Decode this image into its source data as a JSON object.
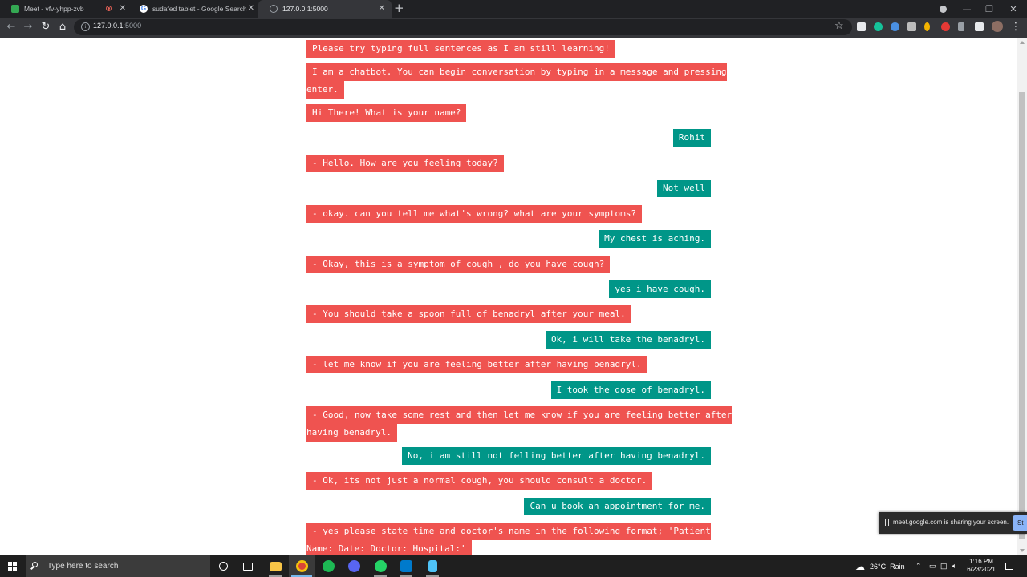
{
  "browser": {
    "tabs": [
      {
        "title": "Meet - vfv-yhpp-zvb",
        "favicon_color": "#34a853",
        "recording": true,
        "active": false
      },
      {
        "title": "sudafed tablet - Google Search",
        "favicon_color": "#ffffff",
        "recording": false,
        "active": false
      },
      {
        "title": "127.0.0.1:5000",
        "favicon_color": "#9aa0a6",
        "recording": false,
        "active": true
      }
    ],
    "new_tab_icon": "plus-icon",
    "address": {
      "host": "127.0.0.1",
      "port": ":5000"
    }
  },
  "chat": {
    "bot_color": "#ef5350",
    "user_color": "#009688",
    "messages": [
      {
        "sender": "bot",
        "lines": [
          "Please try typing full sentences as I am still learning!"
        ]
      },
      {
        "sender": "bot",
        "lines": [
          "I am a chatbot. You can begin conversation by typing in a message and pressing",
          "enter."
        ]
      },
      {
        "sender": "bot",
        "lines": [
          "Hi There! What is your name?"
        ]
      },
      {
        "sender": "user",
        "lines": [
          "Rohit"
        ]
      },
      {
        "sender": "bot",
        "lines": [
          "- Hello. How are you feeling today?"
        ]
      },
      {
        "sender": "user",
        "lines": [
          "Not well"
        ]
      },
      {
        "sender": "bot",
        "lines": [
          "- okay. can you tell me what's wrong? what are your symptoms?"
        ]
      },
      {
        "sender": "user",
        "lines": [
          "My chest is aching."
        ]
      },
      {
        "sender": "bot",
        "lines": [
          "- Okay, this is a symptom of cough , do you have cough?"
        ]
      },
      {
        "sender": "user",
        "lines": [
          "yes i have cough."
        ]
      },
      {
        "sender": "bot",
        "lines": [
          "- You should take a spoon full of benadryl after your meal."
        ]
      },
      {
        "sender": "user",
        "lines": [
          "Ok, i will take the benadryl."
        ]
      },
      {
        "sender": "bot",
        "lines": [
          "- let me know if you are feeling better after having benadryl."
        ]
      },
      {
        "sender": "user",
        "lines": [
          "I took the dose of benadryl."
        ]
      },
      {
        "sender": "bot",
        "lines": [
          "- Good, now take some rest and then let me know if you are feeling better after",
          "having benadryl."
        ]
      },
      {
        "sender": "user",
        "lines": [
          "No, i am still not felling better after having benadryl."
        ]
      },
      {
        "sender": "bot",
        "lines": [
          "- Ok, its not just a normal cough, you should consult a doctor."
        ]
      },
      {
        "sender": "user",
        "lines": [
          "Can u book an appointment for me."
        ]
      },
      {
        "sender": "bot",
        "lines": [
          "- yes please state time and doctor's name in the following format; 'Patient",
          "Name: Date: Doctor: Hospital:'"
        ]
      }
    ]
  },
  "share_notice": {
    "text": "meet.google.com is sharing your screen.",
    "button_label": "St"
  },
  "taskbar": {
    "search_placeholder": "Type here to search",
    "weather": {
      "temp": "26°C",
      "condition": "Rain"
    },
    "time": "1:16 PM",
    "date": "6/23/2021"
  }
}
